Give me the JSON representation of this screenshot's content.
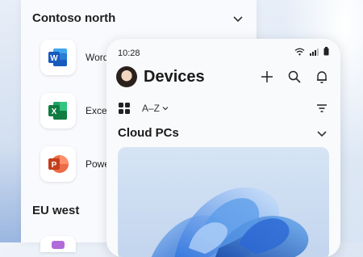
{
  "background": {
    "left_regions": [
      {
        "title": "Contoso north",
        "apps": [
          {
            "label": "Word",
            "icon": "word-icon"
          },
          {
            "label": "Excel",
            "icon": "excel-icon"
          },
          {
            "label": "PowerPoint",
            "icon": "powerpoint-icon"
          }
        ]
      },
      {
        "title": "EU west",
        "apps": []
      }
    ]
  },
  "phone": {
    "status": {
      "time": "10:28",
      "icons": [
        "wifi-icon",
        "signal-icon",
        "battery-icon"
      ]
    },
    "header": {
      "title": "Devices",
      "avatar": "avatar",
      "actions": [
        "add-icon",
        "search-icon",
        "bell-icon"
      ]
    },
    "toolbar": {
      "sort_label": "A–Z",
      "view_icon": "grid-icon",
      "filter_icon": "filter-icon"
    },
    "section": {
      "title": "Cloud PCs"
    }
  },
  "colors": {
    "word": "#185ABD",
    "excel": "#107C41",
    "powerpoint": "#C43E1C",
    "accent": "#2f6fd6"
  }
}
